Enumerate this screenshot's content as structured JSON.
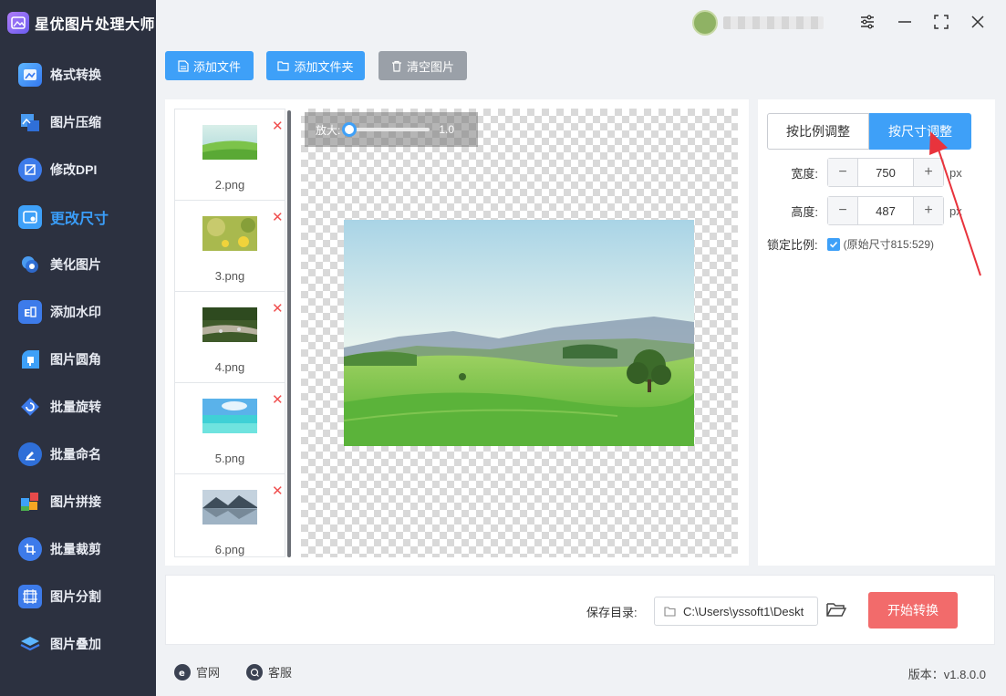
{
  "app": {
    "title": "星优图片处理大师"
  },
  "sidebar": {
    "items": [
      {
        "label": "格式转换",
        "icon": "format-convert-icon"
      },
      {
        "label": "图片压缩",
        "icon": "compress-icon"
      },
      {
        "label": "修改DPI",
        "icon": "dpi-icon"
      },
      {
        "label": "更改尺寸",
        "icon": "resize-icon",
        "active": true
      },
      {
        "label": "美化图片",
        "icon": "beautify-icon"
      },
      {
        "label": "添加水印",
        "icon": "watermark-icon"
      },
      {
        "label": "图片圆角",
        "icon": "round-corner-icon"
      },
      {
        "label": "批量旋转",
        "icon": "rotate-icon"
      },
      {
        "label": "批量命名",
        "icon": "rename-icon"
      },
      {
        "label": "图片拼接",
        "icon": "stitch-icon"
      },
      {
        "label": "批量裁剪",
        "icon": "crop-icon"
      },
      {
        "label": "图片分割",
        "icon": "split-icon"
      },
      {
        "label": "图片叠加",
        "icon": "overlay-icon"
      }
    ]
  },
  "toolbar": {
    "add_file": "添加文件",
    "add_folder": "添加文件夹",
    "clear": "清空图片"
  },
  "files": [
    {
      "name": "2.png"
    },
    {
      "name": "3.png"
    },
    {
      "name": "4.png"
    },
    {
      "name": "5.png"
    },
    {
      "name": "6.png"
    }
  ],
  "preview": {
    "zoom_label": "放大:",
    "zoom_value": "1.0"
  },
  "resize": {
    "mode_ratio": "按比例调整",
    "mode_size": "按尺寸调整",
    "width_label": "宽度:",
    "width_value": "750",
    "height_label": "高度:",
    "height_value": "487",
    "unit": "px",
    "lock_label": "锁定比例:",
    "lock_checked": true,
    "original_note": "(原始尺寸815:529)"
  },
  "output": {
    "save_label": "保存目录:",
    "save_path": "C:\\Users\\yssoft1\\Deskt",
    "start": "开始转换"
  },
  "footer": {
    "website": "官网",
    "service": "客服",
    "version": "版本：v1.8.0.0"
  },
  "colors": {
    "accent": "#3ea0f8",
    "sidebar_bg": "#2c3140",
    "danger": "#f26b6b"
  }
}
